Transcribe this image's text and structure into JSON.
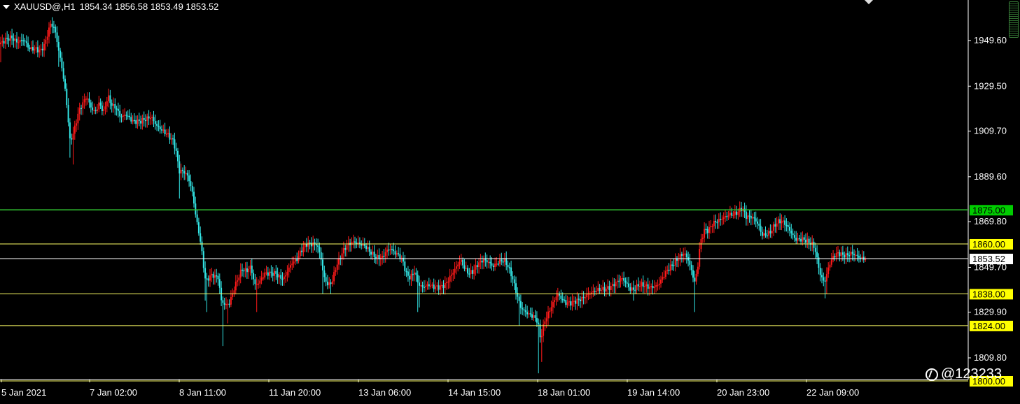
{
  "header": {
    "symbol": "XAUUSD@,H1",
    "ohlc": "1854.34 1856.58 1853.49 1853.52"
  },
  "watermark": "@123233",
  "colors": {
    "background": "#000000",
    "bull_candle": "#ff1a1a",
    "bear_candle": "#33e6e6",
    "support_line": "#ffff66",
    "resistance_line": "#33cc33",
    "price_line": "#ffffff",
    "axis": "#ffffff"
  },
  "chart_data": {
    "type": "candlestick",
    "title": "XAUUSD@,H1",
    "ylim": [
      1800,
      1964
    ],
    "y_ticks": [
      "1949.60",
      "1929.50",
      "1909.70",
      "1889.60",
      "1869.80",
      "1849.70",
      "1829.90",
      "1809.80"
    ],
    "x_ticks": [
      "5 Jan 2021",
      "7 Jan 02:00",
      "8 Jan 11:00",
      "11 Jan 20:00",
      "13 Jan 06:00",
      "14 Jan 15:00",
      "18 Jan 01:00",
      "19 Jan 14:00",
      "20 Jan 23:00",
      "22 Jan 09:00"
    ],
    "grid": false,
    "hlines": [
      {
        "value": 1875.0,
        "label": "1875.00",
        "color": "#33cc33",
        "badge_bg": "#00cc00",
        "badge_fg": "#000000"
      },
      {
        "value": 1860.0,
        "label": "1860.00",
        "color": "#ffff66",
        "badge_bg": "#ffff00",
        "badge_fg": "#000000"
      },
      {
        "value": 1853.52,
        "label": "1853.52",
        "color": "#ffffff",
        "badge_bg": "#ffffff",
        "badge_fg": "#000000"
      },
      {
        "value": 1838.0,
        "label": "1838.00",
        "color": "#ffff66",
        "badge_bg": "#ffff00",
        "badge_fg": "#000000"
      },
      {
        "value": 1824.0,
        "label": "1824.00",
        "color": "#ffff66",
        "badge_bg": "#ffff00",
        "badge_fg": "#000000"
      },
      {
        "value": 1800.0,
        "label": "1800.00",
        "color": "#ffff66",
        "badge_bg": "#ffff00",
        "badge_fg": "#000000"
      }
    ],
    "close_path": [
      [
        0,
        1948
      ],
      [
        8,
        1950
      ],
      [
        16,
        1951
      ],
      [
        24,
        1949
      ],
      [
        34,
        1950
      ],
      [
        42,
        1946
      ],
      [
        50,
        1946
      ],
      [
        58,
        1945
      ],
      [
        64,
        1948
      ],
      [
        72,
        1957
      ],
      [
        78,
        1955
      ],
      [
        84,
        1945
      ],
      [
        90,
        1935
      ],
      [
        96,
        1920
      ],
      [
        100,
        1905
      ],
      [
        106,
        1910
      ],
      [
        112,
        1918
      ],
      [
        118,
        1922
      ],
      [
        124,
        1925
      ],
      [
        130,
        1920
      ],
      [
        136,
        1918
      ],
      [
        142,
        1922
      ],
      [
        148,
        1918
      ],
      [
        154,
        1925
      ],
      [
        160,
        1921
      ],
      [
        166,
        1920
      ],
      [
        172,
        1916
      ],
      [
        180,
        1917
      ],
      [
        190,
        1914
      ],
      [
        200,
        1914
      ],
      [
        208,
        1915
      ],
      [
        216,
        1916
      ],
      [
        224,
        1912
      ],
      [
        232,
        1910
      ],
      [
        240,
        1908
      ],
      [
        248,
        1905
      ],
      [
        252,
        1900
      ],
      [
        256,
        1892
      ],
      [
        262,
        1892
      ],
      [
        268,
        1890
      ],
      [
        274,
        1884
      ],
      [
        278,
        1876
      ],
      [
        282,
        1868
      ],
      [
        286,
        1862
      ],
      [
        290,
        1852
      ],
      [
        294,
        1843
      ],
      [
        300,
        1846
      ],
      [
        306,
        1846
      ],
      [
        312,
        1845
      ],
      [
        316,
        1835
      ],
      [
        322,
        1833
      ],
      [
        328,
        1834
      ],
      [
        334,
        1840
      ],
      [
        340,
        1845
      ],
      [
        346,
        1849
      ],
      [
        352,
        1848
      ],
      [
        358,
        1850
      ],
      [
        364,
        1842
      ],
      [
        370,
        1843
      ],
      [
        378,
        1847
      ],
      [
        386,
        1847
      ],
      [
        394,
        1847
      ],
      [
        400,
        1845
      ],
      [
        406,
        1845
      ],
      [
        412,
        1849
      ],
      [
        418,
        1852
      ],
      [
        424,
        1853
      ],
      [
        430,
        1857
      ],
      [
        438,
        1860
      ],
      [
        446,
        1860
      ],
      [
        452,
        1860
      ],
      [
        458,
        1855
      ],
      [
        462,
        1846
      ],
      [
        468,
        1842
      ],
      [
        474,
        1843
      ],
      [
        480,
        1850
      ],
      [
        486,
        1854
      ],
      [
        492,
        1858
      ],
      [
        498,
        1860
      ],
      [
        506,
        1861
      ],
      [
        514,
        1860
      ],
      [
        522,
        1859
      ],
      [
        530,
        1856
      ],
      [
        538,
        1854
      ],
      [
        546,
        1854
      ],
      [
        552,
        1857
      ],
      [
        558,
        1858
      ],
      [
        564,
        1856
      ],
      [
        570,
        1855
      ],
      [
        576,
        1852
      ],
      [
        580,
        1847
      ],
      [
        586,
        1845
      ],
      [
        592,
        1848
      ],
      [
        598,
        1842
      ],
      [
        604,
        1841
      ],
      [
        612,
        1842
      ],
      [
        620,
        1841
      ],
      [
        628,
        1841
      ],
      [
        636,
        1842
      ],
      [
        644,
        1846
      ],
      [
        652,
        1850
      ],
      [
        658,
        1853
      ],
      [
        664,
        1849
      ],
      [
        670,
        1847
      ],
      [
        676,
        1848
      ],
      [
        682,
        1851
      ],
      [
        690,
        1853
      ],
      [
        698,
        1852
      ],
      [
        704,
        1850
      ],
      [
        712,
        1852
      ],
      [
        720,
        1853
      ],
      [
        726,
        1850
      ],
      [
        732,
        1845
      ],
      [
        738,
        1838
      ],
      [
        744,
        1832
      ],
      [
        750,
        1830
      ],
      [
        756,
        1829
      ],
      [
        762,
        1828
      ],
      [
        768,
        1826
      ],
      [
        772,
        1818
      ],
      [
        778,
        1826
      ],
      [
        784,
        1830
      ],
      [
        790,
        1834
      ],
      [
        796,
        1838
      ],
      [
        802,
        1836
      ],
      [
        808,
        1834
      ],
      [
        816,
        1834
      ],
      [
        824,
        1835
      ],
      [
        832,
        1836
      ],
      [
        840,
        1838
      ],
      [
        848,
        1839
      ],
      [
        856,
        1840
      ],
      [
        864,
        1840
      ],
      [
        872,
        1841
      ],
      [
        880,
        1843
      ],
      [
        888,
        1845
      ],
      [
        894,
        1843
      ],
      [
        900,
        1840
      ],
      [
        906,
        1840
      ],
      [
        912,
        1842
      ],
      [
        918,
        1842
      ],
      [
        926,
        1841
      ],
      [
        934,
        1841
      ],
      [
        940,
        1842
      ],
      [
        946,
        1845
      ],
      [
        952,
        1848
      ],
      [
        958,
        1850
      ],
      [
        964,
        1852
      ],
      [
        970,
        1854
      ],
      [
        976,
        1856
      ],
      [
        982,
        1854
      ],
      [
        988,
        1848
      ],
      [
        992,
        1843
      ],
      [
        996,
        1848
      ],
      [
        1000,
        1860
      ],
      [
        1006,
        1866
      ],
      [
        1012,
        1866
      ],
      [
        1018,
        1869
      ],
      [
        1024,
        1870
      ],
      [
        1030,
        1871
      ],
      [
        1036,
        1872
      ],
      [
        1042,
        1873
      ],
      [
        1048,
        1873
      ],
      [
        1054,
        1874
      ],
      [
        1060,
        1876
      ],
      [
        1066,
        1872
      ],
      [
        1072,
        1872
      ],
      [
        1078,
        1871
      ],
      [
        1084,
        1868
      ],
      [
        1088,
        1864
      ],
      [
        1094,
        1864
      ],
      [
        1100,
        1865
      ],
      [
        1106,
        1868
      ],
      [
        1112,
        1870
      ],
      [
        1118,
        1870
      ],
      [
        1124,
        1868
      ],
      [
        1130,
        1865
      ],
      [
        1136,
        1862
      ],
      [
        1142,
        1862
      ],
      [
        1148,
        1862
      ],
      [
        1154,
        1861
      ],
      [
        1160,
        1860
      ],
      [
        1164,
        1858
      ],
      [
        1168,
        1852
      ],
      [
        1172,
        1846
      ],
      [
        1178,
        1843
      ],
      [
        1182,
        1848
      ],
      [
        1186,
        1852
      ],
      [
        1192,
        1855
      ],
      [
        1198,
        1856
      ],
      [
        1204,
        1855
      ],
      [
        1210,
        1855
      ],
      [
        1216,
        1856
      ],
      [
        1222,
        1855
      ],
      [
        1228,
        1854
      ],
      [
        1234,
        1853.5
      ],
      [
        1238,
        1853.52
      ]
    ],
    "spikes": [
      [
        2,
        1940
      ],
      [
        84,
        1938
      ],
      [
        100,
        1898
      ],
      [
        104,
        1895
      ],
      [
        256,
        1880
      ],
      [
        292,
        1835
      ],
      [
        296,
        1830
      ],
      [
        318,
        1815
      ],
      [
        326,
        1825
      ],
      [
        366,
        1830
      ],
      [
        460,
        1838
      ],
      [
        472,
        1838
      ],
      [
        596,
        1830
      ],
      [
        600,
        1832
      ],
      [
        632,
        1838
      ],
      [
        742,
        1824
      ],
      [
        770,
        1803
      ],
      [
        774,
        1808
      ],
      [
        904,
        1835
      ],
      [
        992,
        1830
      ],
      [
        1178,
        1836
      ],
      [
        1182,
        1838
      ]
    ]
  }
}
